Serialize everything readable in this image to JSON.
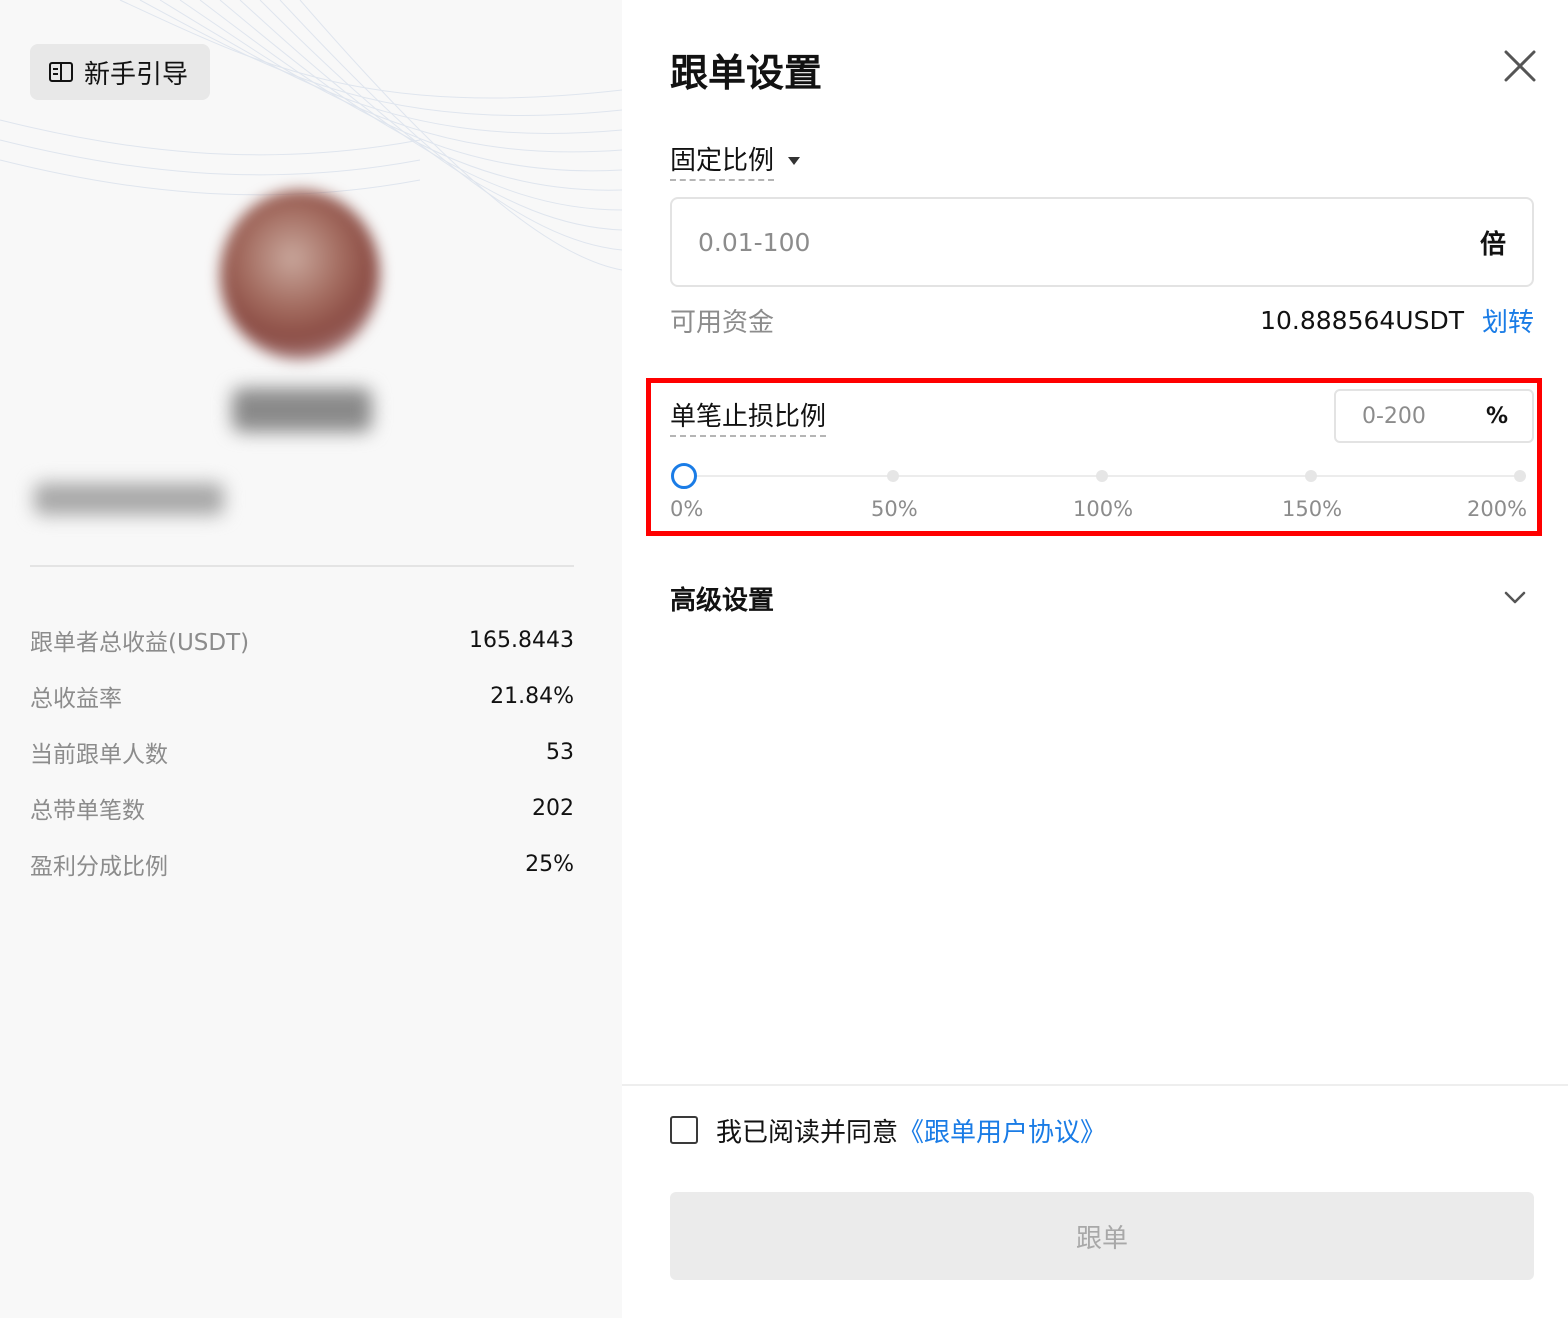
{
  "left": {
    "guide_button": "新手引导",
    "stats": [
      {
        "label": "跟单者总收益(USDT)",
        "value": "165.8443"
      },
      {
        "label": "总收益率",
        "value": "21.84%"
      },
      {
        "label": "当前跟单人数",
        "value": "53"
      },
      {
        "label": "总带单笔数",
        "value": "202"
      },
      {
        "label": "盈利分成比例",
        "value": "25%"
      }
    ]
  },
  "panel": {
    "title": "跟单设置",
    "mode_label": "固定比例",
    "multiplier_placeholder": "0.01-100",
    "multiplier_unit": "倍",
    "available_label": "可用资金",
    "available_amount": "10.888564USDT",
    "transfer_label": "划转",
    "stop_loss": {
      "label": "单笔止损比例",
      "placeholder": "0-200",
      "unit": "%",
      "value_percent": 0,
      "ticks": [
        "0%",
        "50%",
        "100%",
        "150%",
        "200%"
      ]
    },
    "advanced_label": "高级设置",
    "agree_text": "我已阅读并同意",
    "agreement_link": "《跟单用户协议》",
    "submit_label": "跟单"
  },
  "colors": {
    "accent": "#1a7ce6",
    "highlight": "#ff0000",
    "muted": "#8c8c8c"
  }
}
